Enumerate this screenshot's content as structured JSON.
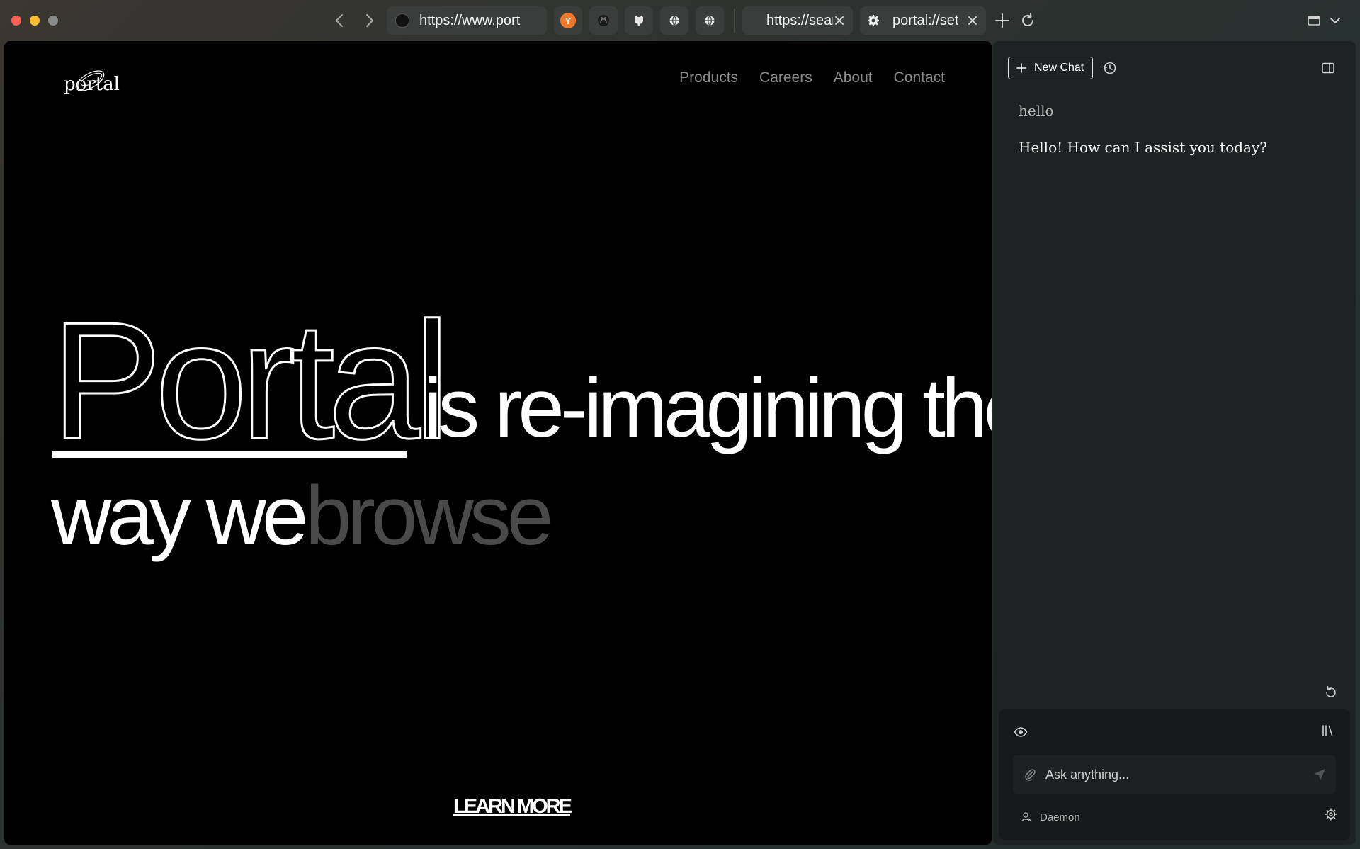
{
  "browser": {
    "address_url": "https://www.port",
    "tabs": [
      {
        "label": "https://sear"
      },
      {
        "label": "portal://set"
      }
    ],
    "pinned_badge": "Y"
  },
  "site": {
    "logo_text": "portal",
    "nav": [
      "Products",
      "Careers",
      "About",
      "Contact"
    ],
    "hero": {
      "brand_word": "Portal",
      "line1_rest": "is re-imagining the",
      "line2_start": "way we",
      "line2_accent": "browse"
    },
    "cta": "LEARN MORE"
  },
  "panel": {
    "new_chat_label": "New Chat",
    "messages": [
      {
        "role": "user",
        "text": "hello"
      },
      {
        "role": "assistant",
        "text": "Hello! How can I assist you today?"
      }
    ],
    "input_placeholder": "Ask anything...",
    "model_name": "Daemon"
  },
  "colors": {
    "page_bg": "#000000",
    "panel_bg": "#1c2322",
    "nav_text": "#8c8c8c",
    "accent_word": "#4a4a4a"
  }
}
